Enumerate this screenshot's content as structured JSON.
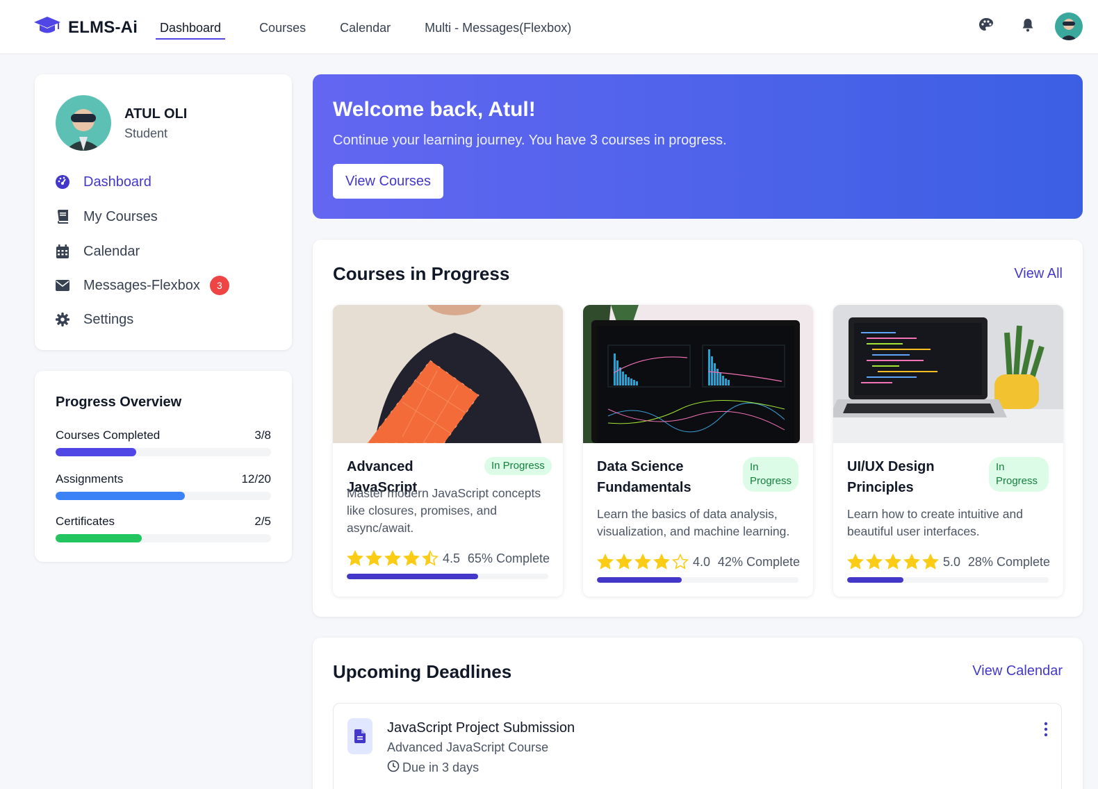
{
  "brand": {
    "name": "ELMS-Ai",
    "icon": "graduation-cap-icon",
    "accent": "#4f46e5"
  },
  "nav": {
    "links": [
      "Dashboard",
      "Courses",
      "Calendar",
      "Multi - Messages(Flexbox)"
    ],
    "active": "Dashboard",
    "icons": [
      "palette-icon",
      "bell-icon",
      "avatar"
    ]
  },
  "profile": {
    "name": "ATUL OLI",
    "role": "Student"
  },
  "sidebar": {
    "items": [
      {
        "label": "Dashboard",
        "icon": "dashboard-icon",
        "active": true
      },
      {
        "label": "My Courses",
        "icon": "book-icon"
      },
      {
        "label": "Calendar",
        "icon": "calendar-icon"
      },
      {
        "label": "Messages-Flexbox",
        "icon": "envelope-icon",
        "badge": "3"
      },
      {
        "label": "Settings",
        "icon": "gear-icon"
      }
    ]
  },
  "progress_overview": {
    "title": "Progress Overview",
    "rows": [
      {
        "label": "Courses Completed",
        "value": "3/8",
        "fraction": 0.375,
        "color": "#4f46e5"
      },
      {
        "label": "Assignments",
        "value": "12/20",
        "fraction": 0.6,
        "color": "#3b82f6"
      },
      {
        "label": "Certificates",
        "value": "2/5",
        "fraction": 0.4,
        "color": "#22c55e"
      }
    ]
  },
  "hero": {
    "title": "Welcome back, Atul!",
    "subtitle": "Continue your learning journey. You have 3 courses in progress.",
    "button": "View Courses"
  },
  "courses_section": {
    "title": "Courses in Progress",
    "link": "View All",
    "courses": [
      {
        "title": "Advanced JavaScript",
        "status": "In Progress",
        "description": "Master modern JavaScript concepts like closures, promises, and async/await.",
        "rating": "4.5",
        "stars": 4.5,
        "complete": "65% Complete",
        "progress": 0.65
      },
      {
        "title": "Data Science Fundamentals",
        "status": "In Progress",
        "description": "Learn the basics of data analysis, visualization, and machine learning.",
        "rating": "4.0",
        "stars": 4.0,
        "complete": "42% Complete",
        "progress": 0.42
      },
      {
        "title": "UI/UX Design Principles",
        "status": "In Progress",
        "description": "Learn how to create intuitive and beautiful user interfaces.",
        "rating": "5.0",
        "stars": 5.0,
        "complete": "28% Complete",
        "progress": 0.28
      }
    ]
  },
  "deadlines_section": {
    "title": "Upcoming Deadlines",
    "link": "View Calendar",
    "items": [
      {
        "title": "JavaScript Project Submission",
        "course": "Advanced JavaScript Course",
        "due": "Due in 3 days",
        "icon": "document-icon"
      }
    ]
  }
}
